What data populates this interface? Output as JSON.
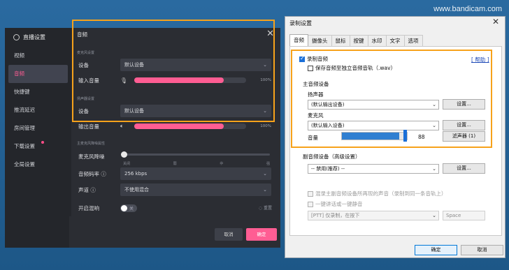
{
  "watermark": "www.bandicam.com",
  "dark_window": {
    "title": "直播设置",
    "nav": [
      {
        "label": "视频",
        "active": false,
        "dot": false
      },
      {
        "label": "音频",
        "active": true,
        "dot": false
      },
      {
        "label": "快捷键",
        "active": false,
        "dot": false
      },
      {
        "label": "推流延迟",
        "active": false,
        "dot": false
      },
      {
        "label": "房间管理",
        "active": false,
        "dot": false
      },
      {
        "label": "下载设置",
        "active": false,
        "dot": true
      },
      {
        "label": "全局设置",
        "active": false,
        "dot": false
      }
    ],
    "panel_title": "音频",
    "mic_section": "麦克风设置",
    "mic_device_label": "设备",
    "mic_device_value": "默认设备",
    "mic_volume_label": "输入音量",
    "mic_volume_pct": "100%",
    "mic_volume_level": 0.8,
    "speaker_section": "扬声器设置",
    "speaker_device_label": "设备",
    "speaker_device_value": "默认设备",
    "speaker_volume_label": "输出音量",
    "speaker_volume_pct": "100%",
    "speaker_volume_level": 0.8,
    "noise_section": "主麦克风降噪属性",
    "noise_label": "麦克风降噪",
    "noise_ticks": [
      "关闭",
      "弱",
      "中",
      "强"
    ],
    "bitrate_label": "音频码率 ⓘ",
    "bitrate_value": "256 kbps",
    "channel_label": "声道 ⓘ",
    "channel_value": "不使用混合",
    "reverb_label": "开启混响",
    "reverb_toggle": "关",
    "reverb_reset": "重置",
    "cancel": "取消",
    "confirm": "确定"
  },
  "light_window": {
    "title": "录制设置",
    "tabs": [
      "音频",
      "摄像头",
      "鼠标",
      "按键",
      "水印",
      "文字",
      "选项"
    ],
    "record_audio": "录制音频",
    "save_separate": "保存音频至独立音频音轨（.wav）",
    "help": "[ 帮助 ]",
    "primary_device": "主音频设备",
    "speaker_label": "扬声器",
    "speaker_value": "(默认输出设备)",
    "settings_btn": "设置...",
    "mic_label": "麦克风",
    "mic_value": "(默认输入设备)",
    "volume_label": "音量",
    "volume_value": "88",
    "volume_level": 0.88,
    "filter_btn": "滤声器 (1)",
    "secondary_device": "副音频设备（高级设置）",
    "secondary_value": "-- 禁用(推荐) --",
    "mix_label": "混录主副音频设备所再现的声音（录制到同一条音轨上）",
    "ptt_label": "一键讲话或一键静音",
    "ptt_mode": "[PTT] 仅录制，在按下",
    "ptt_key": "Space",
    "ok": "确定",
    "cancel": "取消"
  }
}
